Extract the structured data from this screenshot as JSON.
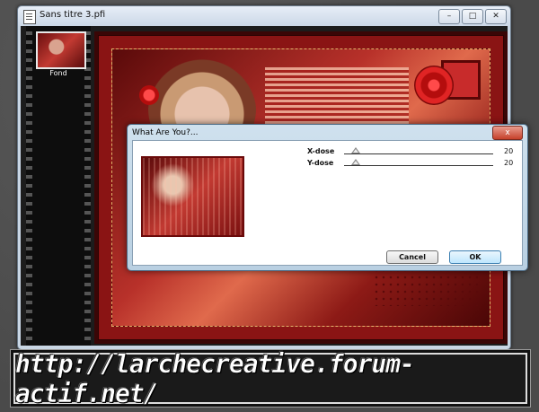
{
  "window": {
    "title": "Sans titre 3.pfi",
    "controls": {
      "minimize": "–",
      "maximize": "□",
      "close": "✕"
    }
  },
  "layers": [
    {
      "label": "Fond"
    }
  ],
  "dialog": {
    "title": "What Are You?...",
    "close": "x",
    "params": [
      {
        "label": "X-dose",
        "value": "20",
        "position": 0.08
      },
      {
        "label": "Y-dose",
        "value": "20",
        "position": 0.08
      }
    ],
    "buttons": {
      "cancel": "Cancel",
      "ok": "OK"
    }
  },
  "banner": {
    "url": "http://larchecreative.forum-actif.net/"
  },
  "colors": {
    "accent": "#b8312a",
    "dialog": "#cfe1ee",
    "ok_button": "#bee6fd"
  }
}
